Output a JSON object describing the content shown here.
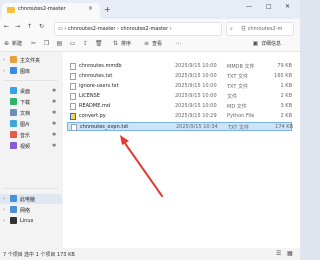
{
  "window": {
    "tab_title": "chnroutes2-master",
    "tab_close": "×",
    "new_tab": "+",
    "minimize": "—",
    "maximize": "□",
    "close": "✕"
  },
  "address": {
    "back": "←",
    "forward": "→",
    "up": "↑",
    "refresh": "↻",
    "crumbs": "▭  ›  chnroutes2-master  ›  chnroutes2-master  ›",
    "search_placeholder": "在 chnroutes2-m"
  },
  "toolbar": {
    "new": "新建",
    "sort": "排序",
    "view": "查看",
    "details": "详细信息"
  },
  "sidebar": {
    "items": [
      {
        "label": "主文件夹"
      },
      {
        "label": "图库"
      },
      {
        "label": "桌面"
      },
      {
        "label": "下载"
      },
      {
        "label": "文档"
      },
      {
        "label": "图片"
      },
      {
        "label": "音乐"
      },
      {
        "label": "视频"
      },
      {
        "label": "此电脑"
      },
      {
        "label": "网络"
      },
      {
        "label": "Linux"
      }
    ]
  },
  "files": [
    {
      "name": "chnroutes.mmdb",
      "date": "2025/9/15 10:00",
      "type": "MMDB 文件",
      "size": "79 KB"
    },
    {
      "name": "chnroutes.txt",
      "date": "2025/9/15 10:00",
      "type": "TXT 文件",
      "size": "165 KB"
    },
    {
      "name": "ignore-users.txt",
      "date": "2025/9/15 10:00",
      "type": "TXT 文件",
      "size": "1 KB"
    },
    {
      "name": "LICENSE",
      "date": "2025/9/15 10:00",
      "type": "文件",
      "size": "2 KB"
    },
    {
      "name": "README.md",
      "date": "2025/9/15 10:00",
      "type": "MD 文件",
      "size": "3 KB"
    },
    {
      "name": "convert.py",
      "date": "2025/9/15 10:29",
      "type": "Python File",
      "size": "2 KB"
    },
    {
      "name": "chnroutes_ovpn.txt",
      "date": "2025/9/15 10:34",
      "type": "TXT 文件",
      "size": "174 KB"
    }
  ],
  "status": {
    "count": "7 个项目",
    "selected": "选中 1 个项目  173 KB"
  },
  "colors": {
    "accent": "#0067c0",
    "selection": "#cce3f8",
    "arrow": "#e53a2f"
  }
}
